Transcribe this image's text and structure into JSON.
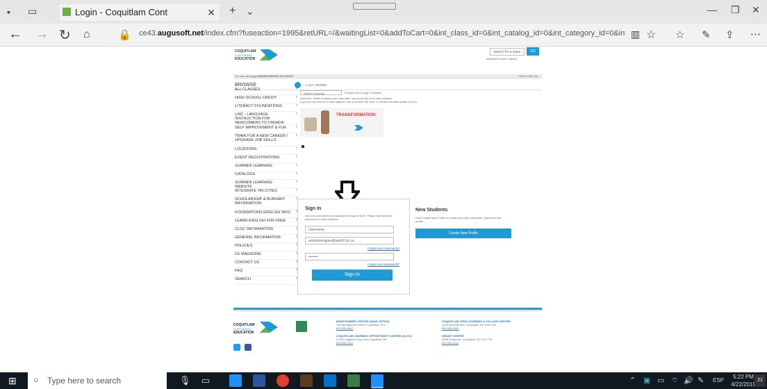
{
  "browser": {
    "tab_title": "Login - Coquitlam Cont",
    "url_prefix": "ce43.",
    "url_domain": "augusoft.net",
    "url_rest": "/index.cfm?fuseaction=1995&retURL=/&waitingList=0&addToCart=0&int_class_id=0&int_catalog_id=0&int_category_id=0&int_su"
  },
  "header": {
    "logo_text_1": "COQUITLAM",
    "logo_text_2": "EDUCATION",
    "search_placeholder": "search for a class...",
    "go_label": "GO",
    "advanced_search": "advanced search options"
  },
  "topbar": {
    "not_logged_in": "You are not logged in",
    "create_account": "LOGIN/CREATE ACCOUNT",
    "cart": "VIEW CART (0)"
  },
  "sidebar": {
    "browse_label": "BROWSE",
    "last_viewed": "LAST VIEWED",
    "items": [
      "ALL CLASSES",
      "HIGH SCHOOL CREDIT",
      "LITERACY FOUNDATIONS",
      "LINC - LANGUAGE INSTRUCTION FOR NEWCOMERS TO CANADA",
      "SELF IMPROVEMENT & FUN",
      "TRAIN FOR A NEW CAREER / UPGRADE JOB SKILLS",
      "LOCATIONS",
      "EVENT REGISTRATIONS",
      "SUMMER LEARNING",
      "CATALOGS",
      "SUMMER LEARNING WEBSITE",
      "INTEGRATE TRI-CITIES",
      "SCHOLARSHIP & BURSARY INFORMATION",
      "FOUNDATIONS ENGLISH INFO",
      "LEARN ENGLISH FOR FREE",
      "CLOC INFORMATION",
      "GENERAL INFORMATION",
      "POLICIES",
      "CE MAGAZINE",
      "CONTACT US",
      "FAQ",
      "SEARCH"
    ]
  },
  "main": {
    "select_language": "Select Language",
    "powered_by": "Powered by Google Translate",
    "welcome_text": "Welcome. When creating your username, you must use an e-mail address.",
    "welcome_text_2": "If you do not have an e-mail address, call us at 604.939.4007 to create a student profile for you.",
    "banner_title": "TRANSFORMATION"
  },
  "signin": {
    "title": "Sign In",
    "desc": "Use your username and password to sign in here. Please note that the password is case sensitive.",
    "username_select": "Username",
    "email_value": "antonbmmguer@anti43.bc.ca",
    "forgot_username": "Forgot your username?",
    "password_value": "••••••••",
    "forgot_password": "Forgot your password?",
    "button": "Sign In"
  },
  "newstudents": {
    "title": "New Students",
    "desc": "Click Create New Profile to create your own username, password and profile.",
    "button": "Create New Profile"
  },
  "footer": {
    "logo_1": "COQUITLAM",
    "logo_2": "EDUCATION",
    "col1_title": "MONTGOMERY CENTRE (MAIN OFFICE)",
    "col1_addr": "780 Montgomery Street, Coquitlam, B.C.",
    "col1_phone": "604.939.4007",
    "col1b_title": "COQUITLAM LEARNING OPPORTUNITY CENTRE (CLOC)",
    "col1b_addr": "2748 Lougheed Hwy, Port Coquitlam, BC",
    "col1b_phone": "604.945.4211",
    "col2_title": "COQUITLAM OPEN LEARNING & VILLAGE CENTRE",
    "col2_addr": "1432 Brunette Ave, Coquitlam, BC V3K 6X6",
    "col2_phone": "604.936.4261",
    "col2b_title": "GRANT CENTRE",
    "col2b_addr": "1905 Grant Ave, Coquitlam, BC V3J 7T8",
    "col2b_phone": "604.945.4211"
  },
  "taskbar": {
    "search_placeholder": "Type here to search",
    "lang": "ESP",
    "time": "5:22 PM",
    "date": "4/22/2019",
    "notif_count": "21"
  }
}
